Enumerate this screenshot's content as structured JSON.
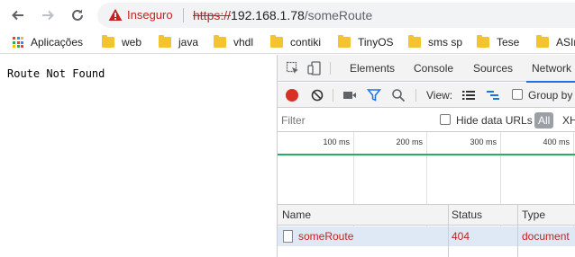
{
  "browser": {
    "security_label": "Inseguro",
    "url_scheme": "https://",
    "url_host": "192.168.1.78",
    "url_path": "/someRoute"
  },
  "bookmarks": [
    {
      "label": "Aplicações",
      "icon": "apps-grid-icon"
    },
    {
      "label": "web",
      "icon": "folder-icon"
    },
    {
      "label": "java",
      "icon": "folder-icon"
    },
    {
      "label": "vhdl",
      "icon": "folder-icon"
    },
    {
      "label": "contiki",
      "icon": "folder-icon"
    },
    {
      "label": "TinyOS",
      "icon": "folder-icon"
    },
    {
      "label": "sms sp",
      "icon": "folder-icon"
    },
    {
      "label": "Tese",
      "icon": "folder-icon"
    },
    {
      "label": "ASIr",
      "icon": "folder-icon"
    }
  ],
  "page": {
    "body_text": "Route Not Found"
  },
  "devtools": {
    "tabs": [
      "Elements",
      "Console",
      "Sources",
      "Network"
    ],
    "active_tab": "Network",
    "view_label": "View:",
    "group_by_label": "Group by",
    "filter_placeholder": "Filter",
    "hide_data_urls_label": "Hide data URLs",
    "all_chip": "All",
    "xhr_label": "XH",
    "timeline_ticks": [
      "100 ms",
      "200 ms",
      "300 ms",
      "400 ms"
    ],
    "columns": [
      "Name",
      "Status",
      "Type"
    ],
    "requests": [
      {
        "name": "someRoute",
        "status": "404",
        "type": "document"
      }
    ],
    "colors": {
      "error_text": "#c5221f",
      "record": "#d93025",
      "accent": "#1a73e8",
      "timeline": "#27ae60"
    }
  }
}
